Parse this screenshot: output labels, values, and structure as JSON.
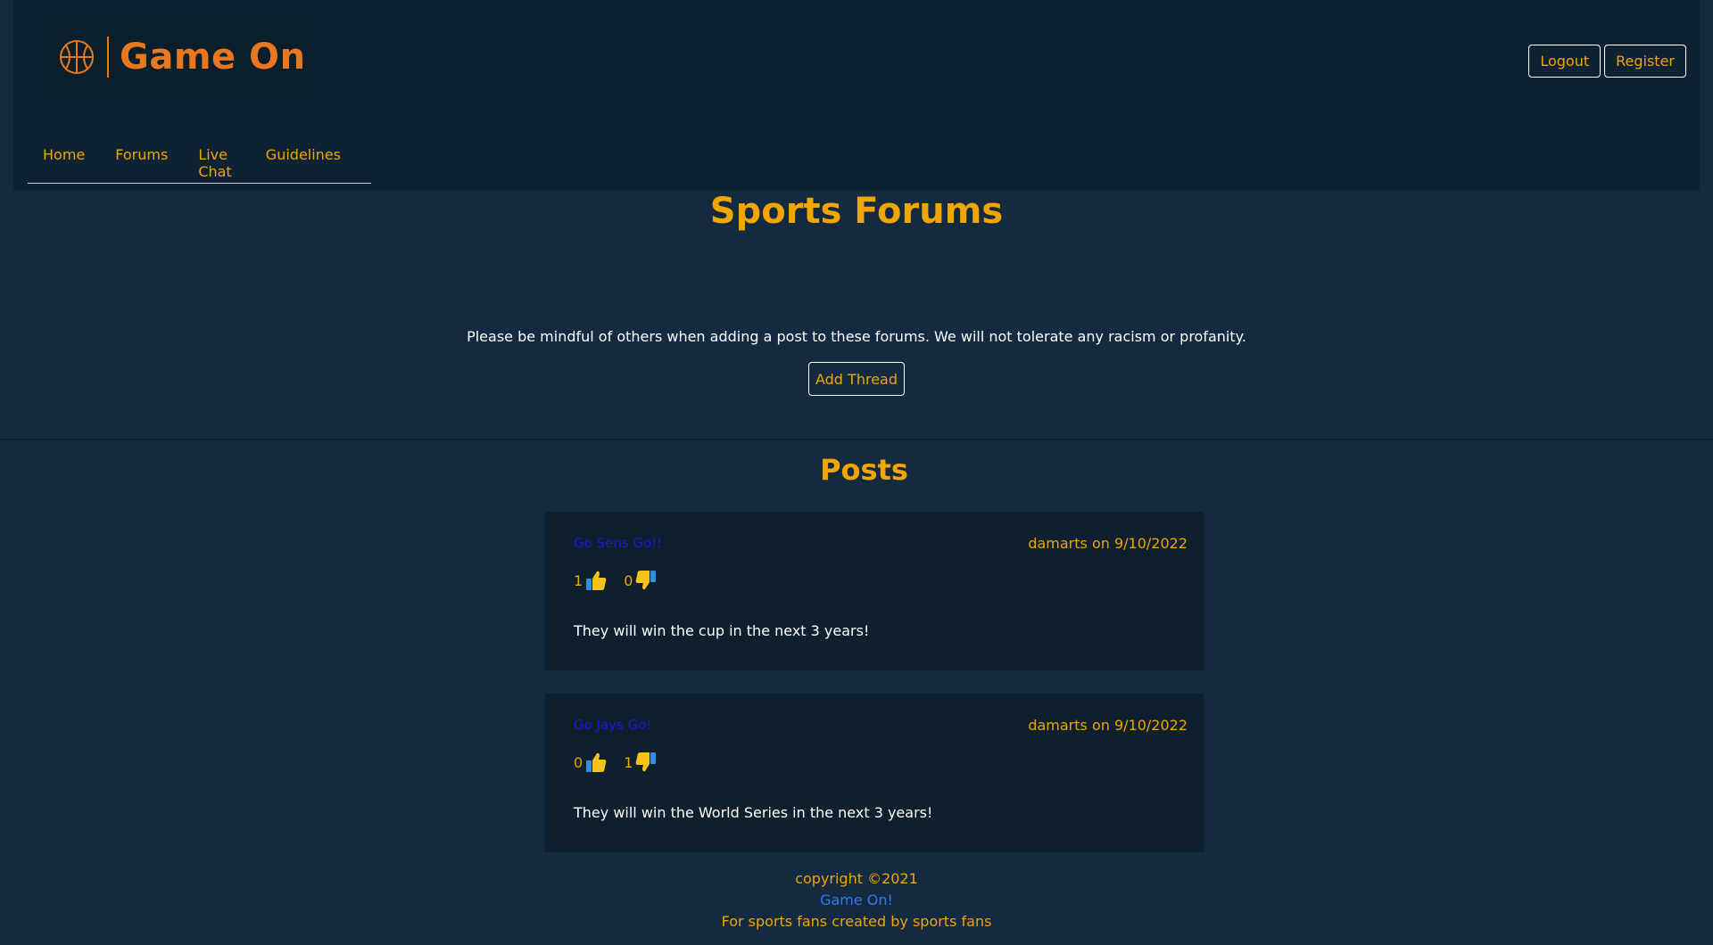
{
  "brand": {
    "name": "Game On",
    "logo_icon": "basketball-icon",
    "accent": "#e87722"
  },
  "auth": {
    "logout_label": "Logout",
    "register_label": "Register"
  },
  "nav": {
    "items": [
      {
        "label": "Home"
      },
      {
        "label": "Forums"
      },
      {
        "label": "Live Chat"
      },
      {
        "label": "Guidelines"
      }
    ]
  },
  "page": {
    "title": "Sports Forums",
    "notice": "Please be mindful of others when adding a post to these forums. We will not tolerate any racism or profanity.",
    "add_thread_label": "Add Thread",
    "posts_heading": "Posts"
  },
  "posts": [
    {
      "title": "Go Sens Go!!",
      "meta": "damarts on 9/10/2022",
      "likes": "1",
      "dislikes": "0",
      "body": "They will win the cup in the next 3 years!"
    },
    {
      "title": "Go Jays Go!",
      "meta": "damarts on 9/10/2022",
      "likes": "0",
      "dislikes": "1",
      "body": "They will win the World Series in the next 3 years!"
    }
  ],
  "footer": {
    "copyright": "copyright ©2021",
    "brand_link": "Game On!",
    "tagline": "For sports fans created by sports fans"
  },
  "colors": {
    "background": "#132a40",
    "header": "#0f2234",
    "card": "#0e1f2d",
    "accent": "#f0a500",
    "link": "#2f7cf0"
  }
}
